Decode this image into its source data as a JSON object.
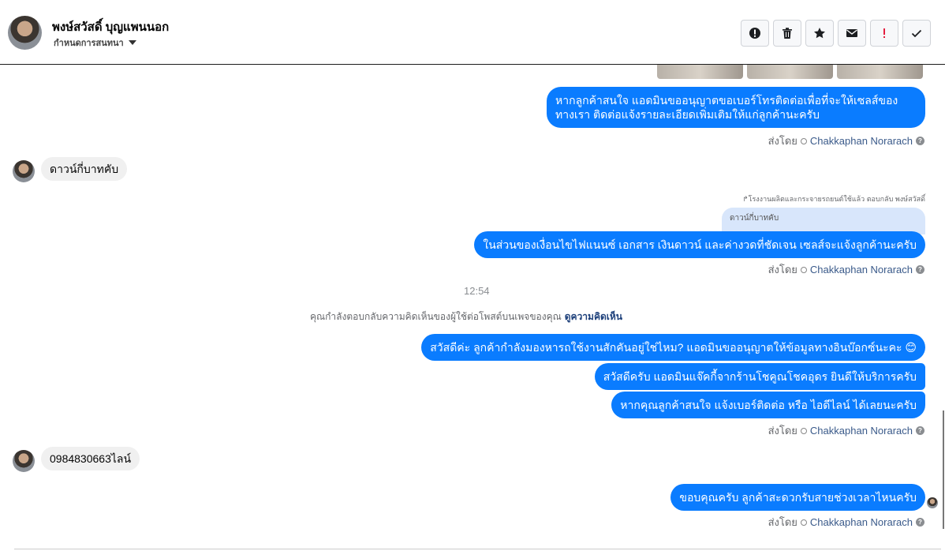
{
  "header": {
    "name": "พงษ์สวัสดิ์ บุญแพนนอก",
    "assign_label": "กำหนดการสนทนา",
    "toolbar": [
      {
        "icon": "alert-circle-icon"
      },
      {
        "icon": "trash-icon"
      },
      {
        "icon": "star-icon"
      },
      {
        "icon": "envelope-icon"
      },
      {
        "icon": "exclamation-icon",
        "color": "#e41e3f"
      },
      {
        "icon": "check-icon"
      }
    ]
  },
  "messages": {
    "out1": "หากลูกค้าสนใจ แอดมินขออนุญาตขอเบอร์โทรติดต่อเพื่อที่จะให้เซลส์ของทางเรา ติดต่อแจ้งรายละเอียดเพิ่มเติมให้แก่ลูกค้านะครับ",
    "in1": "ดาวน์กี่บาทคับ",
    "reply_label": "โรงงานผลิตและกระจายรถยนต์ใช้แล้ว ตอบกลับ พงษ์สวัสดิ์",
    "quoted": "ดาวน์กี่บาทคับ",
    "out2": "ในส่วนของเงื่อนไขไฟแนนซ์ เอกสาร เงินดาวน์ และค่างวดที่ชัดเจน เซลส์จะแจ้งลูกค้านะครับ",
    "time": "12:54",
    "notice": "คุณกำลังตอบกลับความคิดเห็นของผู้ใช้ต่อโพสต์บนเพจของคุณ",
    "notice_link": "ดูความคิดเห็น",
    "out3": "สวัสดีค่ะ ลูกค้ากำลังมองหารถใช้งานสักคันอยู่ใช่ไหม? แอดมินขออนุญาตให้ข้อมูลทางอินบ๊อกซ์นะคะ 😊",
    "out4": "สวัสดีครับ แอดมินแจ๊คกี้จากร้านโชคูณโชคอุดร ยินดีให้บริการครับ",
    "out5": "หากคุณลูกค้าสนใจ แจ้งเบอร์ติดต่อ หรือ ไอดีไลน์ ได้เลยนะครับ",
    "in2": "0984830663ไลน์",
    "out6": "ขอบคุณครับ ลูกค้าสะดวกรับสายช่วงเวลาไหนครับ"
  },
  "sent_by": {
    "prefix": "ส่งโดย",
    "agent": "Chakkaphan Norarach"
  },
  "colors": {
    "outgoing_bubble": "#0a7cff",
    "incoming_bubble": "#f0f0f0"
  }
}
